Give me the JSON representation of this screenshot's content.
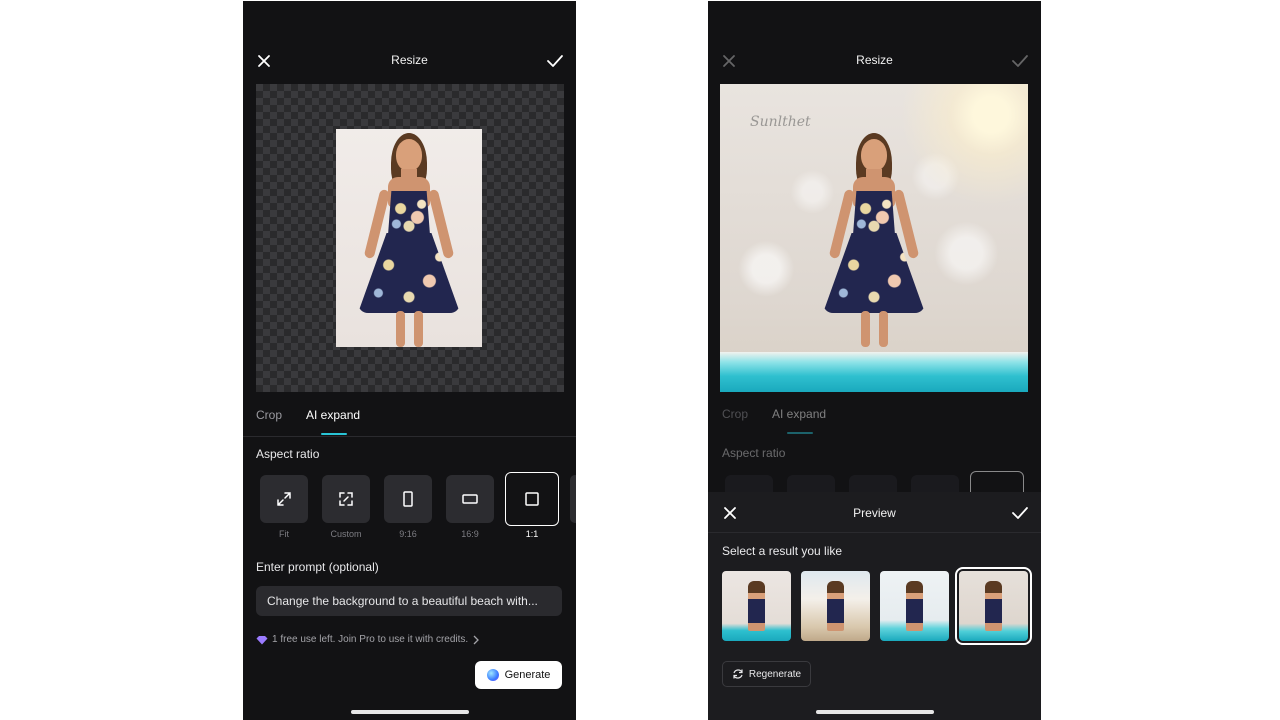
{
  "left": {
    "title": "Resize",
    "tabs": [
      "Crop",
      "AI expand"
    ],
    "aspect_ratio_label": "Aspect ratio",
    "ratios": [
      {
        "label": "Fit",
        "icon": "expand-arrows-icon"
      },
      {
        "label": "Custom",
        "icon": "custom-frame-icon"
      },
      {
        "label": "9:16",
        "icon": "portrait-rect-icon"
      },
      {
        "label": "16:9",
        "icon": "landscape-rect-icon"
      },
      {
        "label": "1:1",
        "icon": "square-icon"
      }
    ],
    "selected_ratio": "1:1",
    "prompt_label": "Enter prompt (optional)",
    "prompt_value": "Change the background to a beautiful beach with...",
    "credit_text": "1 free use left. Join Pro to use it with credits.",
    "generate_label": "Generate"
  },
  "right": {
    "title": "Resize",
    "tabs": [
      "Crop",
      "AI expand"
    ],
    "aspect_ratio_label": "Aspect ratio",
    "watermark": "Sunlthet",
    "preview_title": "Preview",
    "select_label": "Select a result you like",
    "regenerate_label": "Regenerate",
    "selected_result_index": 4
  },
  "colors": {
    "accent": "#29c4d6",
    "background": "#121214",
    "sheet": "#1c1c1f"
  }
}
